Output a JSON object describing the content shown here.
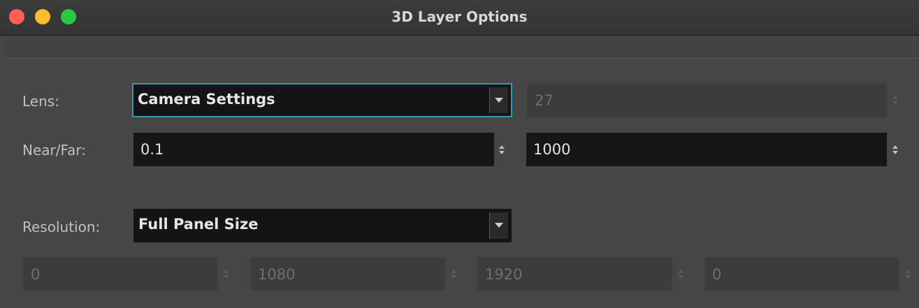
{
  "window": {
    "title": "3D Layer Options",
    "traffic_lights": {
      "close": "#fe5f57",
      "minimize": "#febc2e",
      "maximize": "#28c840"
    }
  },
  "lens": {
    "label": "Lens:",
    "selected": "Camera Settings",
    "value": "27"
  },
  "near_far": {
    "label": "Near/Far:",
    "near": "0.1",
    "far": "1000"
  },
  "resolution": {
    "label": "Resolution:",
    "selected": "Full Panel Size",
    "fields": [
      "0",
      "1080",
      "1920",
      "0"
    ]
  },
  "colors": {
    "focus_ring": "#3e95b0",
    "field_background": "#161616",
    "panel_background": "#464646"
  },
  "icons": {
    "dropdown": "chevron-down-icon",
    "stepper": "stepper-arrows-icon"
  }
}
